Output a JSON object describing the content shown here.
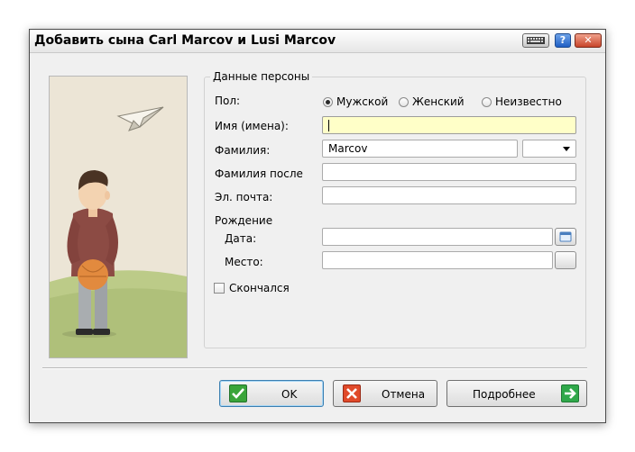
{
  "window": {
    "title": "Добавить сына Carl Marcov и Lusi Marcov"
  },
  "titlebar": {
    "keyboard_icon": "keyboard-icon",
    "help_label": "?",
    "close_label": "✕"
  },
  "group": {
    "title": "Данные персоны"
  },
  "gender": {
    "label": "Пол:",
    "options": [
      "Мужской",
      "Женский",
      "Неизвестно"
    ],
    "selected": "Мужской"
  },
  "fields": {
    "given_names": {
      "label": "Имя (имена):",
      "value": ""
    },
    "surname": {
      "label": "Фамилия:",
      "value": "Marcov",
      "suffix_value": ""
    },
    "surname_after": {
      "label": "Фамилия после",
      "value": ""
    },
    "email": {
      "label": "Эл. почта:",
      "value": ""
    }
  },
  "birth": {
    "section_label": "Рождение",
    "date_label": "Дата:",
    "date_value": "",
    "place_label": "Место:",
    "place_value": ""
  },
  "deceased": {
    "label": "Скончался",
    "checked": false
  },
  "buttons": {
    "ok": "OK",
    "cancel": "Отмена",
    "more": "Подробнее"
  },
  "colors": {
    "focus_field": "#ffffc8",
    "ok_icon": "#3aa53a",
    "cancel_icon": "#e04a2a",
    "more_icon": "#2fa84a"
  }
}
